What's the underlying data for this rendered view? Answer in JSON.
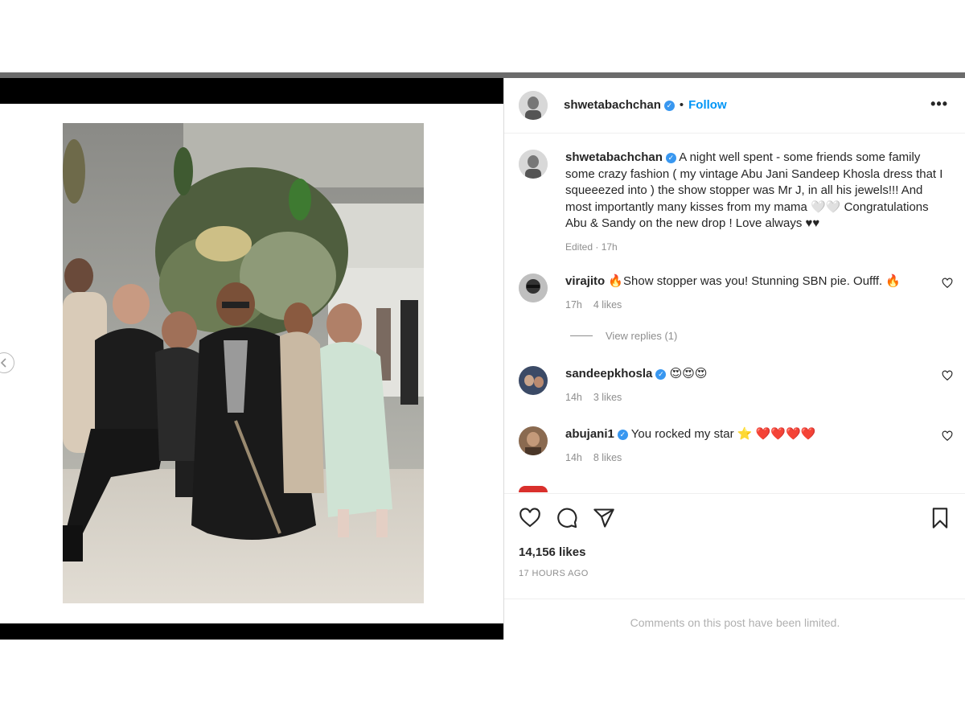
{
  "post": {
    "username": "shwetabachchan",
    "follow_label": "Follow",
    "dot": "•",
    "more_label": "•••",
    "caption": "A night well spent - some friends some family some crazy fashion ( my vintage Abu Jani Sandeep Khosla dress that I squeeezed into ) the show stopper was Mr J, in all his jewels!!! And most importantly many kisses from my mama 🤍🤍 Congratulations Abu & Sandy on the new drop ! Love always ♥♥",
    "caption_meta": "Edited · 17h",
    "likes": "14,156 likes",
    "time_ago": "17 HOURS AGO",
    "limited_notice": "Comments on this post have been limited."
  },
  "comments": [
    {
      "username": "virajito",
      "verified": false,
      "text": "🔥Show stopper was you! Stunning SBN pie. Oufff. 🔥",
      "time": "17h",
      "likes": "4 likes"
    },
    {
      "username": "sandeepkhosla",
      "verified": true,
      "text": "😍😍😍",
      "time": "14h",
      "likes": "3 likes"
    },
    {
      "username": "abujani1",
      "verified": true,
      "text": "You rocked my star ⭐ ❤️❤️❤️❤️",
      "time": "14h",
      "likes": "8 likes"
    }
  ],
  "view_replies": "View replies (1)",
  "icons": {
    "like": "heart-icon",
    "comment": "comment-icon",
    "share": "share-icon",
    "save": "bookmark-icon",
    "verified": "verified-badge-icon",
    "more": "more-options-icon",
    "prev": "chevron-left-icon"
  },
  "colors": {
    "link": "#0095f6",
    "verified": "#3897f0",
    "muted": "#8e8e8e",
    "text": "#262626"
  }
}
